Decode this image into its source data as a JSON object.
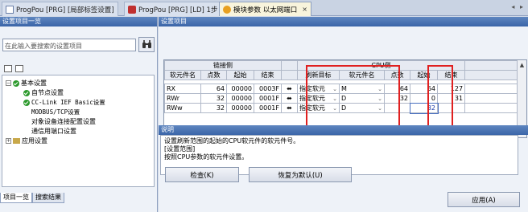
{
  "tabs": [
    {
      "label": "ProgPou [PRG] [局部标签设置]"
    },
    {
      "label": "ProgPou [PRG] [LD] 1步"
    },
    {
      "label": "模块参数 以太网端口"
    }
  ],
  "tab_close": "×",
  "tab_nav": "◂ ▸",
  "left_panel": {
    "title": "设置项目一览",
    "search_placeholder": "在此输入要搜索的设置项目",
    "tree": {
      "root": "基本设置",
      "children": [
        "自节点设置",
        "CC-Link IEF Basic设置",
        "MODBUS/TCP设置",
        "对象设备连接配置设置",
        "通信用端口设置"
      ],
      "app": "应用设置"
    },
    "bottom_tabs": [
      "项目一览",
      "搜索结果"
    ]
  },
  "right_panel": {
    "title": "设置项目",
    "link_side": "链接侧",
    "cpu_side": "CPU侧",
    "headers_link": [
      "软元件名",
      "点数",
      "起始",
      "结束"
    ],
    "headers_cpu": [
      "刷新目标",
      "软元件名",
      "点数",
      "起始",
      "结束"
    ],
    "rows": [
      {
        "dev": "RX",
        "pts": "64",
        "start": "00000",
        "end": "0003F",
        "target": "指定软元",
        "cdev": "M",
        "cpts": "64",
        "cstart": "64",
        "cend": "127"
      },
      {
        "dev": "RWr",
        "pts": "32",
        "start": "00000",
        "end": "0001F",
        "target": "指定软元",
        "cdev": "D",
        "cpts": "32",
        "cstart": "0",
        "cend": "31"
      },
      {
        "dev": "RWw",
        "pts": "32",
        "start": "00000",
        "end": "0001F",
        "target": "指定软元",
        "cdev": "D",
        "cpts": "",
        "cstart": "32",
        "cend": ""
      }
    ],
    "desc_title": "说明",
    "desc_lines": [
      "设置刷新范围的起始的CPU软元件的软元件号。",
      "[设置范围]",
      "按照CPU参数的软元件设置。"
    ],
    "buttons": {
      "check": "检查(K)",
      "restore": "恢复为默认(U)",
      "apply": "应用(A)"
    }
  },
  "colors": {
    "highlight": "#e02020",
    "title_bar": "#3a65a8"
  }
}
